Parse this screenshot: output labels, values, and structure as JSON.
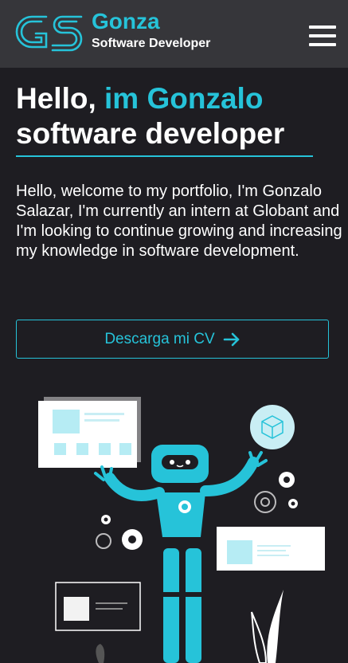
{
  "header": {
    "logo_icon": "gs-monogram-logo",
    "name": "Gonza",
    "subtitle": "Software Developer",
    "menu_icon": "hamburger-icon"
  },
  "hero": {
    "title_prefix": "Hello, ",
    "title_accent": "im Gonzalo",
    "title_line2": "software developer",
    "intro": "Hello, welcome to my portfolio, I'm Gonzalo Salazar, I'm currently an intern at Globant and I'm looking to continue growing and increasing my knowledge in software development.",
    "cv_button_label": "Descarga mi CV",
    "cv_button_icon": "arrow-right-icon"
  },
  "illustration": {
    "subject": "robot-with-floating-ui-cards-and-gears"
  },
  "colors": {
    "accent": "#26c3d9",
    "background": "#1e1d22",
    "header": "#36363a",
    "text": "#ffffff"
  }
}
